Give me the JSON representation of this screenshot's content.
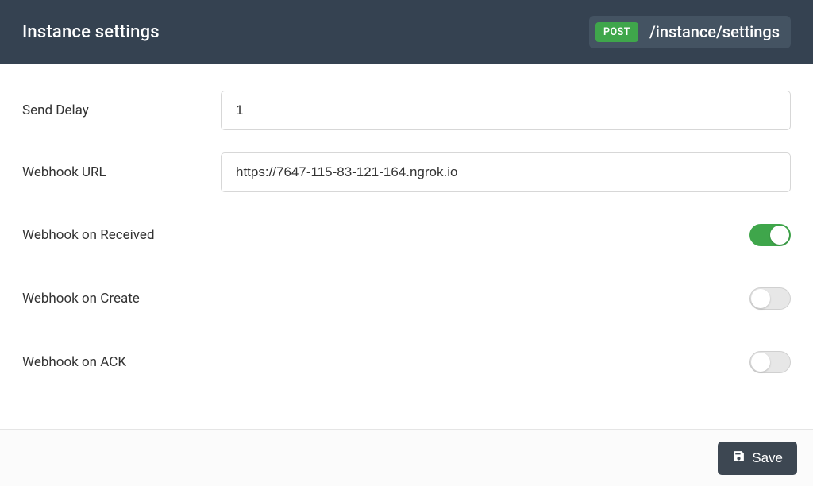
{
  "header": {
    "title": "Instance settings",
    "method": "POST",
    "endpoint": "/instance/settings"
  },
  "fields": {
    "send_delay": {
      "label": "Send Delay",
      "value": "1"
    },
    "webhook_url": {
      "label": "Webhook URL",
      "value": "https://7647-115-83-121-164.ngrok.io"
    },
    "webhook_received": {
      "label": "Webhook on Received",
      "on": true
    },
    "webhook_create": {
      "label": "Webhook on Create",
      "on": false
    },
    "webhook_ack": {
      "label": "Webhook on ACK",
      "on": false
    }
  },
  "footer": {
    "save_label": "Save"
  }
}
